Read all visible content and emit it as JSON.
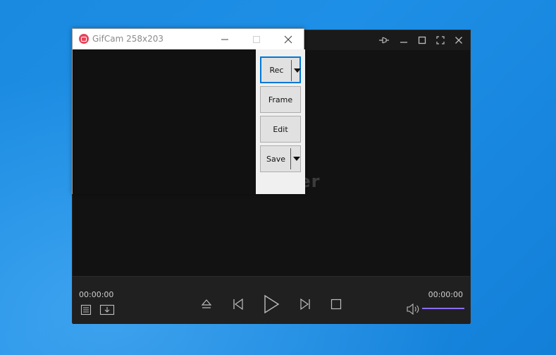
{
  "kmplayer": {
    "logo_text": "KMPlayer",
    "time_elapsed": "00:00:00",
    "time_total": "00:00:00",
    "volume_level": 1.0,
    "accent_color": "#8c6cff"
  },
  "gifcam": {
    "title": "GifCam 258x203",
    "buttons": {
      "rec": "Rec",
      "frame": "Frame",
      "edit": "Edit",
      "save": "Save"
    },
    "icon_color": "#e8445a",
    "focus_color": "#0078d7"
  },
  "icons": {
    "kmp_titlebar": [
      "pin-icon",
      "minimize-icon",
      "maximize-icon",
      "fullscreen-icon",
      "close-icon"
    ],
    "kmp_controls": [
      "playlist-icon",
      "download-icon",
      "eject-icon",
      "previous-icon",
      "play-icon",
      "next-icon",
      "stop-icon",
      "volume-icon"
    ],
    "gifcam_titlebar": [
      "gifcam-app-icon",
      "minimize-icon",
      "maximize-icon",
      "close-icon"
    ]
  }
}
